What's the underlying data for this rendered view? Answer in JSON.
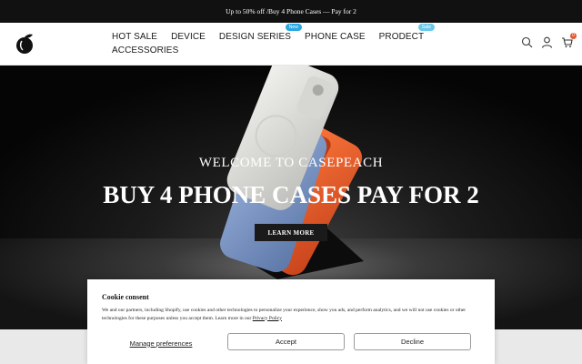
{
  "announcement": {
    "text": "Up to 50% off /Buy 4 Phone Cases — Pay for 2"
  },
  "header": {
    "nav": [
      {
        "label": "HOT SALE"
      },
      {
        "label": "DEVICE"
      },
      {
        "label": "DESIGN SERIES",
        "badge": "New",
        "badge_color": "#2aa8e0"
      },
      {
        "label": "PHONE CASE"
      },
      {
        "label": "PRODECT",
        "badge": "Sale",
        "badge_color": "#6cc8e8"
      },
      {
        "label": "ACCESSORIES"
      }
    ],
    "icons": [
      "search-icon",
      "account-icon",
      "cart-icon"
    ],
    "cart_count": "0",
    "cart_badge_color": "#e8552b"
  },
  "hero": {
    "subtitle": "WELCOME TO CASEPEACH",
    "title": "BUY 4 PHONE CASES PAY FOR 2",
    "button": "LEARN MORE"
  },
  "cookie": {
    "title": "Cookie consent",
    "text": "We and our partners, including Shopify, use cookies and other technologies to personalize your experience, show you ads, and perform analytics, and we will not use cookies or other technologies for these purposes unless you accept them. Learn more in our ",
    "link": "Privacy Policy",
    "manage": "Manage preferences",
    "accept": "Accept",
    "decline": "Decline"
  },
  "colors": {
    "accent_orange": "#e8552b",
    "case_white": "#e2e2df",
    "case_blue": "#7a96c8"
  }
}
